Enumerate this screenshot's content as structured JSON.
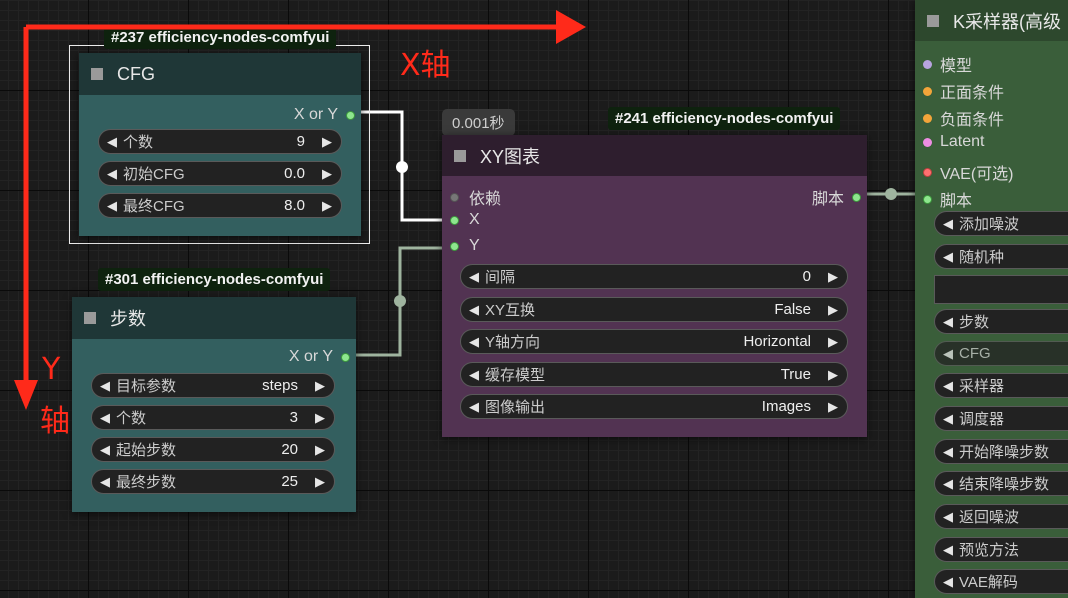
{
  "annotations": {
    "x_axis": "X轴",
    "y_axis_1": "Y",
    "y_axis_2": "轴"
  },
  "colors": {
    "annotation": "#ff2a1a",
    "teal_node": "#335f5f",
    "purple_node": "#523352",
    "green_node": "#3a5e3a",
    "link": "#9fb49f"
  },
  "nodes": {
    "cfg": {
      "badge": "#237 efficiency-nodes-comfyui",
      "title": "CFG",
      "output": "X or Y",
      "widgets": [
        {
          "label": "个数",
          "value": "9"
        },
        {
          "label": "初始CFG",
          "value": "0.0"
        },
        {
          "label": "最终CFG",
          "value": "8.0"
        }
      ]
    },
    "steps": {
      "badge": "#301 efficiency-nodes-comfyui",
      "title": "步数",
      "output": "X or Y",
      "widgets": [
        {
          "label": "目标参数",
          "value": "steps"
        },
        {
          "label": "个数",
          "value": "3"
        },
        {
          "label": "起始步数",
          "value": "20"
        },
        {
          "label": "最终步数",
          "value": "25"
        }
      ]
    },
    "xy": {
      "timer": "0.001秒",
      "badge": "#241 efficiency-nodes-comfyui",
      "title": "XY图表",
      "inputs": [
        "依赖",
        "X",
        "Y"
      ],
      "output": "脚本",
      "widgets": [
        {
          "label": "间隔",
          "value": "0"
        },
        {
          "label": "XY互换",
          "value": "False"
        },
        {
          "label": "Y轴方向",
          "value": "Horizontal"
        },
        {
          "label": "缓存模型",
          "value": "True"
        },
        {
          "label": "图像输出",
          "value": "Images"
        }
      ]
    },
    "ksampler": {
      "title": "K采样器(高级",
      "inputs": [
        {
          "label": "模型",
          "color": "purple"
        },
        {
          "label": "正面条件",
          "color": "orange"
        },
        {
          "label": "负面条件",
          "color": "orange"
        },
        {
          "label": "Latent",
          "color": "pink"
        },
        {
          "label": "VAE(可选)",
          "color": "red"
        },
        {
          "label": "脚本",
          "color": "green"
        }
      ],
      "widgets": [
        {
          "label": "添加噪波"
        },
        {
          "label": "随机种"
        },
        {
          "label": ""
        },
        {
          "label": "步数"
        },
        {
          "label": "CFG"
        },
        {
          "label": "采样器"
        },
        {
          "label": "调度器"
        },
        {
          "label": "开始降噪步数"
        },
        {
          "label": "结束降噪步数"
        },
        {
          "label": "返回噪波"
        },
        {
          "label": "预览方法"
        },
        {
          "label": "VAE解码"
        }
      ]
    }
  }
}
